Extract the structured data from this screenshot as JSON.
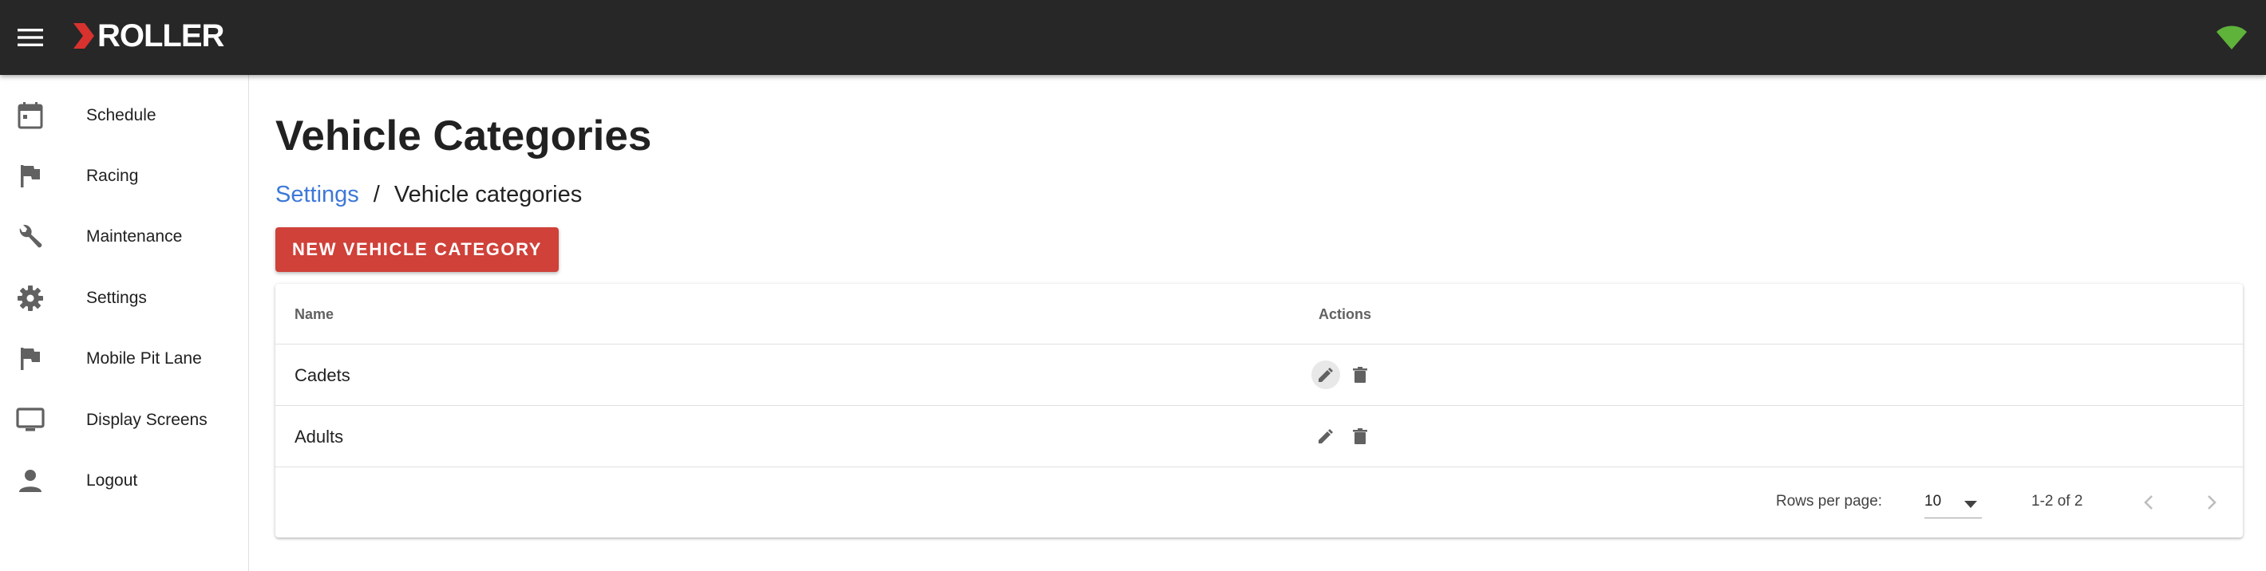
{
  "app": {
    "brand": "ROLLER",
    "accent_color": "#cf4139",
    "topbar_color": "#272727",
    "status_icon": "wifi-icon"
  },
  "sidebar": {
    "items": [
      {
        "label": "Schedule",
        "icon": "calendar-icon"
      },
      {
        "label": "Racing",
        "icon": "flag-icon"
      },
      {
        "label": "Maintenance",
        "icon": "wrench-icon"
      },
      {
        "label": "Settings",
        "icon": "gear-icon"
      },
      {
        "label": "Mobile Pit Lane",
        "icon": "flag-icon"
      },
      {
        "label": "Display Screens",
        "icon": "monitor-icon"
      },
      {
        "label": "Logout",
        "icon": "person-icon"
      }
    ]
  },
  "page": {
    "title": "Vehicle Categories",
    "breadcrumb": {
      "parent": "Settings",
      "separator": "/",
      "current": "Vehicle categories"
    },
    "new_button_label": "NEW VEHICLE CATEGORY"
  },
  "table": {
    "columns": [
      "Name",
      "Actions"
    ],
    "rows": [
      {
        "name": "Cadets",
        "actions": [
          "edit-icon",
          "delete-icon"
        ]
      },
      {
        "name": "Adults",
        "actions": [
          "edit-icon",
          "delete-icon"
        ]
      }
    ],
    "footer": {
      "rows_per_page_label": "Rows per page:",
      "rows_per_page_value": "10",
      "page_info": "1-2 of 2"
    }
  }
}
